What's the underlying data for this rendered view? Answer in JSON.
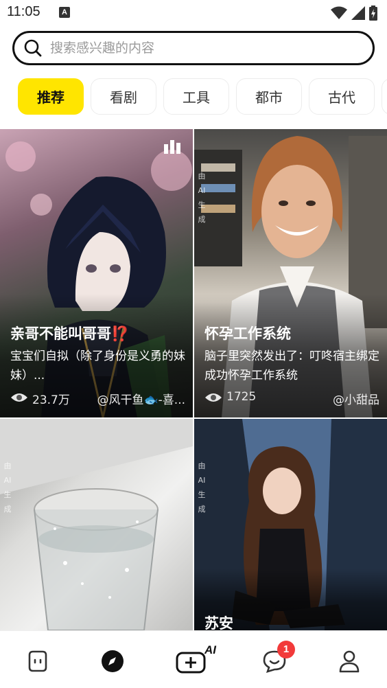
{
  "status_bar": {
    "time": "11:05",
    "notification_letter": "A"
  },
  "search": {
    "placeholder": "搜索感兴趣的内容",
    "value": ""
  },
  "tabs": [
    {
      "label": "推荐",
      "active": true
    },
    {
      "label": "看剧",
      "active": false
    },
    {
      "label": "工具",
      "active": false
    },
    {
      "label": "都市",
      "active": false
    },
    {
      "label": "古代",
      "active": false
    }
  ],
  "cards": [
    {
      "title": "亲哥不能叫哥哥⁉️",
      "description": "宝宝们自拟（除了身份是义勇的妹妹）...",
      "views": "23.7万",
      "author": "@风干鱼🐟-喜..."
    },
    {
      "title": "怀孕工作系统",
      "description": "脑子里突然发出了：叮咚宿主绑定成功怀孕工作系统",
      "views": "1725",
      "author": "@小甜品"
    },
    {
      "title": "",
      "ai_tag": "由AI生成"
    },
    {
      "title": "苏安",
      "ai_tag": "由AI生成"
    }
  ],
  "ai_tag_chars": [
    "由",
    "AI",
    "生",
    "成"
  ],
  "bottom_nav": {
    "items": [
      "home-icon",
      "discover-icon",
      "create-ai-icon",
      "messages-icon",
      "profile-icon"
    ],
    "create_label": "AI",
    "messages_badge": "1"
  },
  "colors": {
    "accent": "#ffe500",
    "badge": "#f23a3a",
    "text": "#111111"
  }
}
